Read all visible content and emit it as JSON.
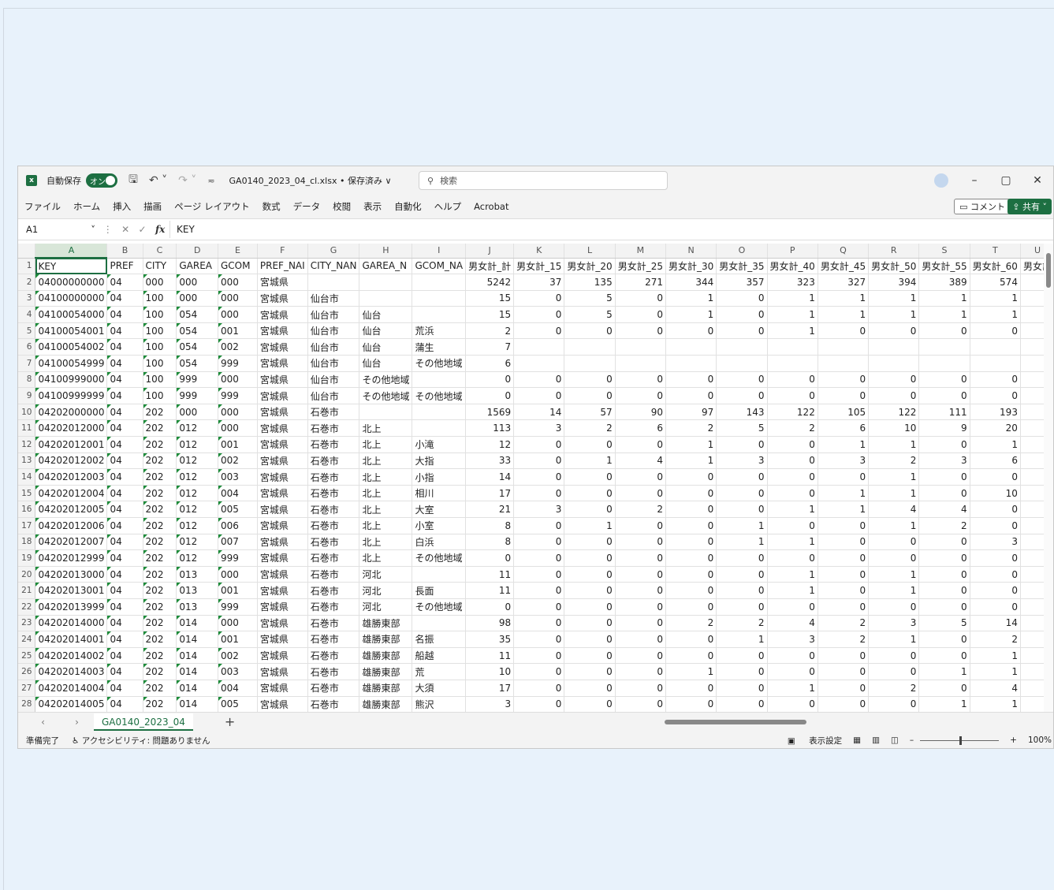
{
  "titlebar": {
    "autosave_label": "自動保存",
    "autosave_state": "オン",
    "filename": "GA0140_2023_04_cl.xlsx • 保存済み ∨",
    "search_placeholder": "検索"
  },
  "menu": [
    "ファイル",
    "ホーム",
    "挿入",
    "描画",
    "ページ レイアウト",
    "数式",
    "データ",
    "校閲",
    "表示",
    "自動化",
    "ヘルプ",
    "Acrobat"
  ],
  "buttons": {
    "comment": "コメント",
    "share": "共有"
  },
  "formula_bar": {
    "name_box": "A1",
    "value": "KEY"
  },
  "columns": [
    "A",
    "B",
    "C",
    "D",
    "E",
    "F",
    "G",
    "H",
    "I",
    "J",
    "K",
    "L",
    "M",
    "N",
    "O",
    "P",
    "Q",
    "R",
    "S",
    "T",
    "U"
  ],
  "column_widths": [
    88,
    60,
    60,
    60,
    60,
    60,
    60,
    60,
    62,
    60,
    60,
    60,
    60,
    60,
    60,
    60,
    60,
    60,
    60,
    60,
    30
  ],
  "rows": [
    [
      "KEY",
      "PREF",
      "CITY",
      "GAREA",
      "GCOM",
      "PREF_NAI",
      "CITY_NAN",
      "GAREA_N",
      "GCOM_NA",
      "男女計_計",
      "男女計_15",
      "男女計_20",
      "男女計_25",
      "男女計_30",
      "男女計_35",
      "男女計_40",
      "男女計_45",
      "男女計_50",
      "男女計_55",
      "男女計_60",
      "男女計"
    ],
    [
      "04000000000",
      "04",
      "000",
      "000",
      "000",
      "宮城県",
      "",
      "",
      "",
      "5242",
      "37",
      "135",
      "271",
      "344",
      "357",
      "323",
      "327",
      "394",
      "389",
      "574",
      "("
    ],
    [
      "04100000000",
      "04",
      "100",
      "000",
      "000",
      "宮城県",
      "仙台市",
      "",
      "",
      "15",
      "0",
      "5",
      "0",
      "1",
      "0",
      "1",
      "1",
      "1",
      "1",
      "1",
      ""
    ],
    [
      "04100054000",
      "04",
      "100",
      "054",
      "000",
      "宮城県",
      "仙台市",
      "仙台",
      "",
      "15",
      "0",
      "5",
      "0",
      "1",
      "0",
      "1",
      "1",
      "1",
      "1",
      "1",
      ""
    ],
    [
      "04100054001",
      "04",
      "100",
      "054",
      "001",
      "宮城県",
      "仙台市",
      "仙台",
      "荒浜",
      "2",
      "0",
      "0",
      "0",
      "0",
      "0",
      "1",
      "0",
      "0",
      "0",
      "0",
      ""
    ],
    [
      "04100054002",
      "04",
      "100",
      "054",
      "002",
      "宮城県",
      "仙台市",
      "仙台",
      "蒲生",
      "7",
      "",
      "",
      "",
      "",
      "",
      "",
      "",
      "",
      "",
      "",
      ""
    ],
    [
      "04100054999",
      "04",
      "100",
      "054",
      "999",
      "宮城県",
      "仙台市",
      "仙台",
      "その他地域",
      "6",
      "",
      "",
      "",
      "",
      "",
      "",
      "",
      "",
      "",
      "",
      ""
    ],
    [
      "04100999000",
      "04",
      "100",
      "999",
      "000",
      "宮城県",
      "仙台市",
      "その他地域",
      "",
      "0",
      "0",
      "0",
      "0",
      "0",
      "0",
      "0",
      "0",
      "0",
      "0",
      "0",
      ""
    ],
    [
      "04100999999",
      "04",
      "100",
      "999",
      "999",
      "宮城県",
      "仙台市",
      "その他地域",
      "その他地域",
      "0",
      "0",
      "0",
      "0",
      "0",
      "0",
      "0",
      "0",
      "0",
      "0",
      "0",
      ""
    ],
    [
      "04202000000",
      "04",
      "202",
      "000",
      "000",
      "宮城県",
      "石巻市",
      "",
      "",
      "1569",
      "14",
      "57",
      "90",
      "97",
      "143",
      "122",
      "105",
      "122",
      "111",
      "193",
      ":"
    ],
    [
      "04202012000",
      "04",
      "202",
      "012",
      "000",
      "宮城県",
      "石巻市",
      "北上",
      "",
      "113",
      "3",
      "2",
      "6",
      "2",
      "5",
      "2",
      "6",
      "10",
      "9",
      "20",
      ""
    ],
    [
      "04202012001",
      "04",
      "202",
      "012",
      "001",
      "宮城県",
      "石巻市",
      "北上",
      "小滝",
      "12",
      "0",
      "0",
      "0",
      "1",
      "0",
      "0",
      "1",
      "1",
      "0",
      "1",
      ""
    ],
    [
      "04202012002",
      "04",
      "202",
      "012",
      "002",
      "宮城県",
      "石巻市",
      "北上",
      "大指",
      "33",
      "0",
      "1",
      "4",
      "1",
      "3",
      "0",
      "3",
      "2",
      "3",
      "6",
      ""
    ],
    [
      "04202012003",
      "04",
      "202",
      "012",
      "003",
      "宮城県",
      "石巻市",
      "北上",
      "小指",
      "14",
      "0",
      "0",
      "0",
      "0",
      "0",
      "0",
      "0",
      "1",
      "0",
      "0",
      ""
    ],
    [
      "04202012004",
      "04",
      "202",
      "012",
      "004",
      "宮城県",
      "石巻市",
      "北上",
      "相川",
      "17",
      "0",
      "0",
      "0",
      "0",
      "0",
      "0",
      "1",
      "1",
      "0",
      "10",
      ""
    ],
    [
      "04202012005",
      "04",
      "202",
      "012",
      "005",
      "宮城県",
      "石巻市",
      "北上",
      "大室",
      "21",
      "3",
      "0",
      "2",
      "0",
      "0",
      "1",
      "1",
      "4",
      "4",
      "0",
      ""
    ],
    [
      "04202012006",
      "04",
      "202",
      "012",
      "006",
      "宮城県",
      "石巻市",
      "北上",
      "小室",
      "8",
      "0",
      "1",
      "0",
      "0",
      "1",
      "0",
      "0",
      "1",
      "2",
      "0",
      ""
    ],
    [
      "04202012007",
      "04",
      "202",
      "012",
      "007",
      "宮城県",
      "石巻市",
      "北上",
      "白浜",
      "8",
      "0",
      "0",
      "0",
      "0",
      "1",
      "1",
      "0",
      "0",
      "0",
      "3",
      ""
    ],
    [
      "04202012999",
      "04",
      "202",
      "012",
      "999",
      "宮城県",
      "石巻市",
      "北上",
      "その他地域",
      "0",
      "0",
      "0",
      "0",
      "0",
      "0",
      "0",
      "0",
      "0",
      "0",
      "0",
      ""
    ],
    [
      "04202013000",
      "04",
      "202",
      "013",
      "000",
      "宮城県",
      "石巻市",
      "河北",
      "",
      "11",
      "0",
      "0",
      "0",
      "0",
      "0",
      "1",
      "0",
      "1",
      "0",
      "0",
      ""
    ],
    [
      "04202013001",
      "04",
      "202",
      "013",
      "001",
      "宮城県",
      "石巻市",
      "河北",
      "長面",
      "11",
      "0",
      "0",
      "0",
      "0",
      "0",
      "1",
      "0",
      "1",
      "0",
      "0",
      ""
    ],
    [
      "04202013999",
      "04",
      "202",
      "013",
      "999",
      "宮城県",
      "石巻市",
      "河北",
      "その他地域",
      "0",
      "0",
      "0",
      "0",
      "0",
      "0",
      "0",
      "0",
      "0",
      "0",
      "0",
      ""
    ],
    [
      "04202014000",
      "04",
      "202",
      "014",
      "000",
      "宮城県",
      "石巻市",
      "雄勝東部",
      "",
      "98",
      "0",
      "0",
      "0",
      "2",
      "2",
      "4",
      "2",
      "3",
      "5",
      "14",
      ""
    ],
    [
      "04202014001",
      "04",
      "202",
      "014",
      "001",
      "宮城県",
      "石巻市",
      "雄勝東部",
      "名振",
      "35",
      "0",
      "0",
      "0",
      "0",
      "1",
      "3",
      "2",
      "1",
      "0",
      "2",
      ""
    ],
    [
      "04202014002",
      "04",
      "202",
      "014",
      "002",
      "宮城県",
      "石巻市",
      "雄勝東部",
      "船越",
      "11",
      "0",
      "0",
      "0",
      "0",
      "0",
      "0",
      "0",
      "0",
      "0",
      "1",
      ""
    ],
    [
      "04202014003",
      "04",
      "202",
      "014",
      "003",
      "宮城県",
      "石巻市",
      "雄勝東部",
      "荒",
      "10",
      "0",
      "0",
      "0",
      "1",
      "0",
      "0",
      "0",
      "0",
      "1",
      "1",
      ""
    ],
    [
      "04202014004",
      "04",
      "202",
      "014",
      "004",
      "宮城県",
      "石巻市",
      "雄勝東部",
      "大須",
      "17",
      "0",
      "0",
      "0",
      "0",
      "0",
      "1",
      "0",
      "2",
      "0",
      "4",
      ""
    ],
    [
      "04202014005",
      "04",
      "202",
      "014",
      "005",
      "宮城県",
      "石巻市",
      "雄勝東部",
      "熊沢",
      "3",
      "0",
      "0",
      "0",
      "0",
      "0",
      "0",
      "0",
      "0",
      "1",
      "1",
      ""
    ]
  ],
  "sheet_tab": "GA0140_2023_04",
  "status": {
    "ready": "準備完了",
    "accessibility": "アクセシビリティ: 問題ありません",
    "display_settings": "表示設定",
    "zoom": "100%"
  }
}
